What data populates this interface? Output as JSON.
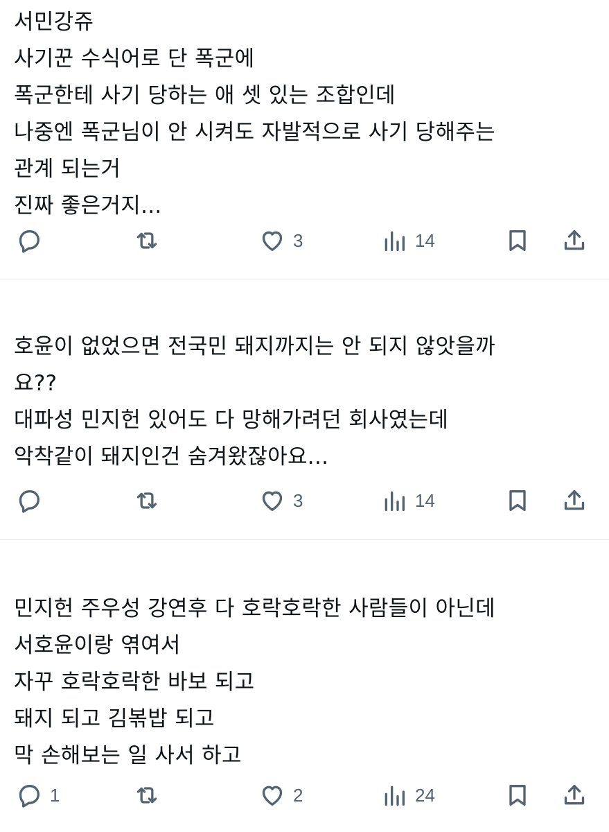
{
  "tweets": [
    {
      "lines": [
        "서민강쥬",
        "사기꾼 수식어로 단 폭군에",
        "폭군한테 사기 당하는 애 셋 있는 조합인데",
        "나중엔 폭군님이 안 시켜도 자발적으로 사기 당해주는",
        "관계 되는거",
        "진짜 좋은거지..."
      ],
      "replies": "",
      "retweets": "",
      "likes": "3",
      "views": "14"
    },
    {
      "lines": [
        "호윤이 없었으면 전국민 돼지까지는 안 되지 않앗을까",
        "요??",
        "대파성 민지헌 있어도 다 망해가려던 회사였는데",
        "악착같이 돼지인건 숨겨왔잖아요..."
      ],
      "replies": "",
      "retweets": "",
      "likes": "3",
      "views": "14"
    },
    {
      "lines": [
        "민지헌 주우성 강연후 다 호락호락한 사람들이 아닌데",
        "서호윤이랑 엮여서",
        "자꾸 호락호락한 바보 되고",
        "돼지 되고 김볶밥 되고",
        "막 손해보는 일 사서 하고"
      ],
      "replies": "1",
      "retweets": "",
      "likes": "2",
      "views": "24"
    }
  ],
  "icons": {
    "reply": "reply-bubble-icon",
    "retweet": "retweet-icon",
    "like": "heart-icon",
    "views": "analytics-bars-icon",
    "bookmark": "bookmark-icon",
    "share": "share-upload-icon"
  },
  "colors": {
    "text": "#0f1419",
    "icon": "#536471",
    "divider": "#e3e6e8",
    "background": "#ffffff"
  }
}
